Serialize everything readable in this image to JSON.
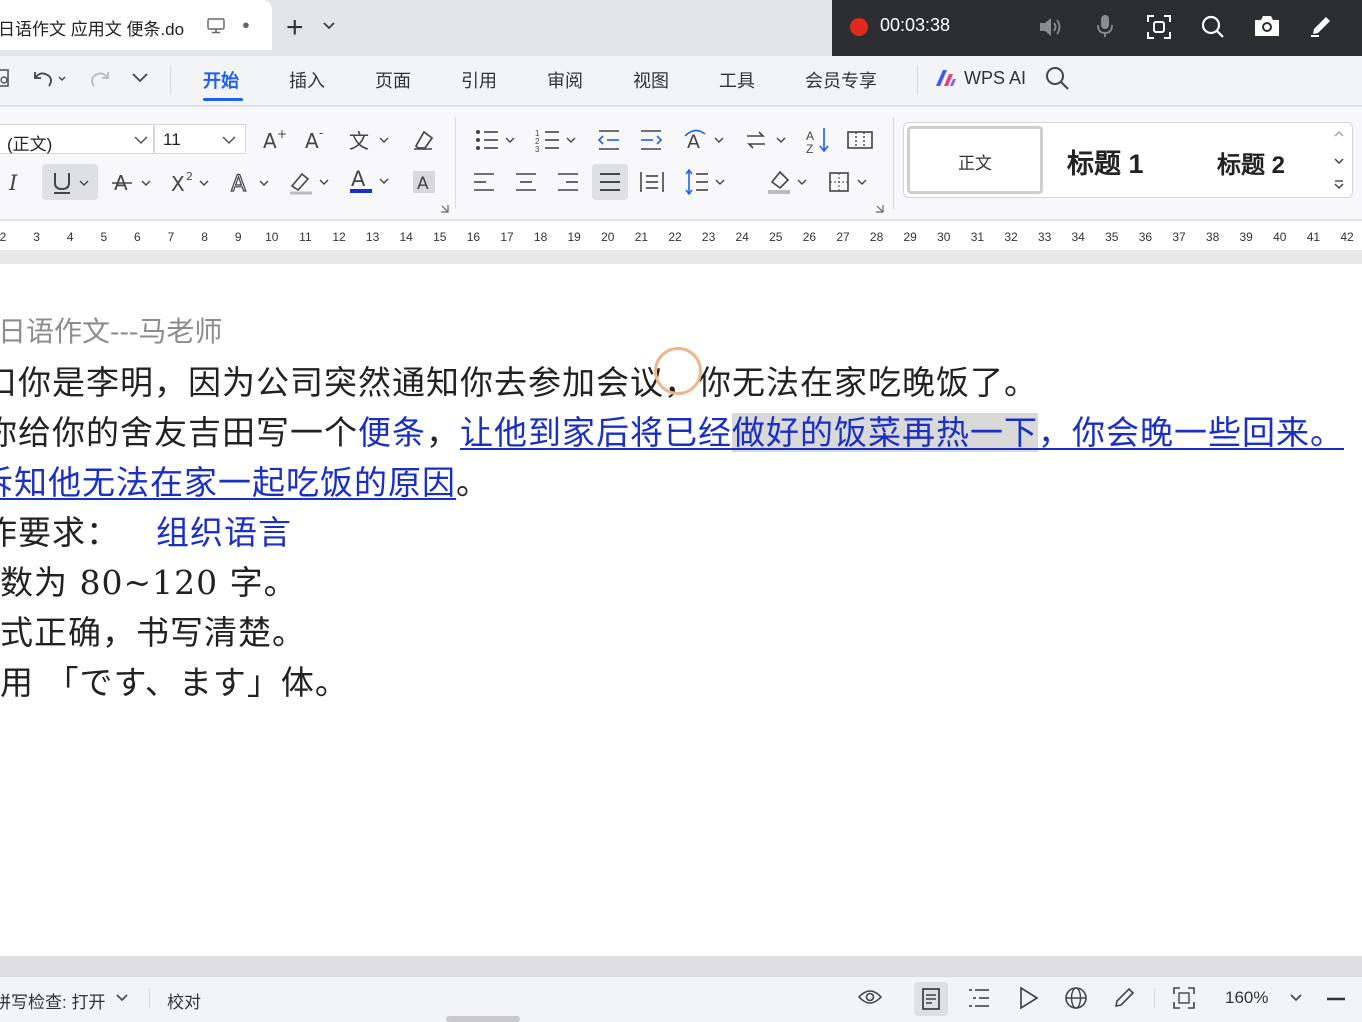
{
  "tab": {
    "title": "日语作文  应用文 便条.do",
    "modified_dot": "●",
    "new_tab": "+"
  },
  "recorder": {
    "time": "00:03:38",
    "status_color": "#e0281f"
  },
  "menu": {
    "items": [
      "开始",
      "插入",
      "页面",
      "引用",
      "审阅",
      "视图",
      "工具",
      "会员专享"
    ],
    "active": "开始",
    "wps_ai": "WPS AI",
    "accent": "#1f60f0"
  },
  "ribbon": {
    "font_name": "(正文)",
    "font_size": "11",
    "styles": {
      "normal": "正文",
      "h1": "标题  1",
      "h2": "标题  2"
    }
  },
  "ruler": {
    "ticks": [
      "2",
      "3",
      "4",
      "5",
      "6",
      "7",
      "8",
      "9",
      "10",
      "11",
      "12",
      "13",
      "14",
      "15",
      "16",
      "17",
      "18",
      "19",
      "20",
      "21",
      "22",
      "23",
      "24",
      "25",
      "26",
      "27",
      "28",
      "29",
      "30",
      "31",
      "32",
      "33",
      "34",
      "35",
      "36",
      "37",
      "38",
      "39",
      "40",
      "41",
      "42"
    ]
  },
  "document": {
    "line1": "日语作文---马老师",
    "line2": "口你是李明，因为公司突然通知你去参加会议，你无法在家吃晚饭了。",
    "line3": {
      "a": "你给你的舍友吉田写一个",
      "b": "便条",
      "c": "，",
      "d": "让他到家后将已经",
      "e": "做好的饭菜再热一下",
      "f": "，你会晚一些回来。"
    },
    "line4": {
      "a": "诉知他无法在家一起吃饭的原因",
      "b": "。"
    },
    "line5": {
      "a": "作要求：",
      "b": "组织语言"
    },
    "line6": "数为  80~120  字。",
    "line7": "式正确，书写清楚。",
    "line8": "用  「です、ます」体。",
    "link_color": "#1a2fc4"
  },
  "status": {
    "spellcheck": "拼写检查: 打开",
    "proofread": "校对",
    "zoom": "160%"
  }
}
